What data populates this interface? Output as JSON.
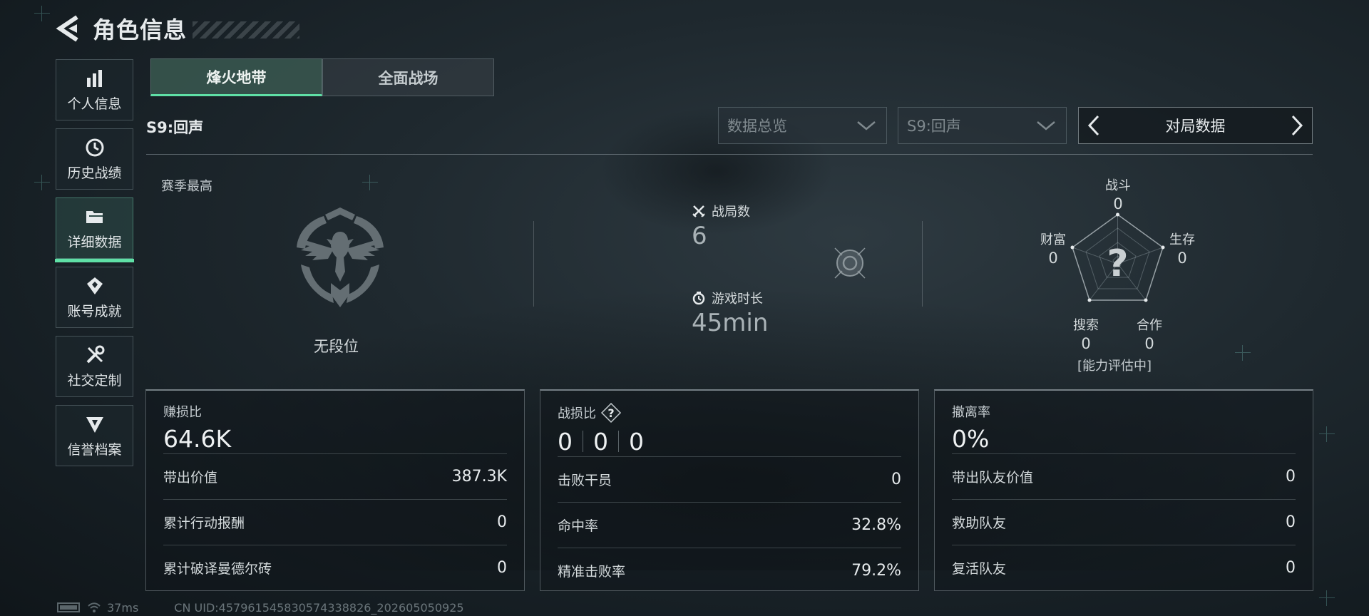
{
  "header": {
    "title": "角色信息"
  },
  "sidebar": {
    "items": [
      {
        "label": "个人信息",
        "icon": "bar-chart-icon"
      },
      {
        "label": "历史战绩",
        "icon": "history-clock-icon"
      },
      {
        "label": "详细数据",
        "icon": "folder-icon",
        "active": true
      },
      {
        "label": "账号成就",
        "icon": "achievement-icon"
      },
      {
        "label": "社交定制",
        "icon": "tools-icon"
      },
      {
        "label": "信誉档案",
        "icon": "shield-icon"
      }
    ]
  },
  "tabs": [
    {
      "label": "烽火地带",
      "active": true
    },
    {
      "label": "全面战场",
      "active": false
    }
  ],
  "season": "S9:回声",
  "filters": {
    "overview_placeholder": "数据总览",
    "season_placeholder": "S9:回声",
    "pager_label": "对局数据"
  },
  "overview": {
    "season_best_label": "赛季最高",
    "rank": "无段位",
    "matches_label": "战局数",
    "matches_value": "6",
    "playtime_label": "游戏时长",
    "playtime_value": "45min"
  },
  "radar": {
    "axes": [
      {
        "label": "战斗",
        "value": "0"
      },
      {
        "label": "生存",
        "value": "0"
      },
      {
        "label": "合作",
        "value": "0"
      },
      {
        "label": "搜索",
        "value": "0"
      },
      {
        "label": "财富",
        "value": "0"
      }
    ],
    "center_mark": "?",
    "note": "[能力评估中]"
  },
  "cards": [
    {
      "title": "赚损比",
      "big": "64.6K",
      "rows": [
        {
          "label": "带出价值",
          "value": "387.3K"
        },
        {
          "label": "累计行动报酬",
          "value": "0"
        },
        {
          "label": "累计破译曼德尔砖",
          "value": "0"
        }
      ]
    },
    {
      "title": "战损比",
      "ratio": [
        "0",
        "0",
        "0"
      ],
      "rows": [
        {
          "label": "击败干员",
          "value": "0"
        },
        {
          "label": "命中率",
          "value": "32.8%"
        },
        {
          "label": "精准击败率",
          "value": "79.2%"
        }
      ]
    },
    {
      "title": "撤离率",
      "big": "0%",
      "rows": [
        {
          "label": "带出队友价值",
          "value": "0"
        },
        {
          "label": "救助队友",
          "value": "0"
        },
        {
          "label": "复活队友",
          "value": "0"
        }
      ]
    }
  ],
  "footer": {
    "ping": "37ms",
    "uid": "CN UID:457961545830574338826_202605050925"
  },
  "colors": {
    "accent": "#5fe0a6",
    "background": "#1f292f",
    "text": "#d4dadc"
  }
}
